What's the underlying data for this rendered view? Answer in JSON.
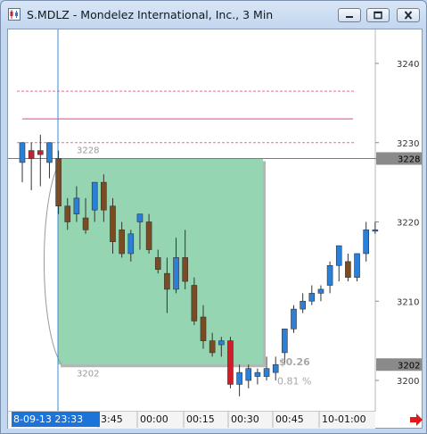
{
  "window": {
    "title": "S.MDLZ - Mondelez International, Inc., 3 Min"
  },
  "controls": {
    "minimize": "minimize-icon",
    "restore": "restore-icon",
    "close": "close-icon"
  },
  "chart_data": {
    "type": "candlestick",
    "symbol": "S.MDLZ",
    "interval": "3 Min",
    "price_axis": {
      "ticks": [
        "3240",
        "3230",
        "3220",
        "3210",
        "3200"
      ],
      "range": [
        3198.5,
        3242.2
      ],
      "current_price_label": "3228",
      "low_price_label": "3202"
    },
    "time_axis": {
      "ticks": [
        "8-09-13 23:33",
        "3:45",
        "00:00",
        "00:15",
        "00:30",
        "00:45",
        "10-01:00"
      ],
      "cursor_label": "8-09-13 23:33"
    },
    "candles": [
      {
        "o": 3227.5,
        "h": 3229.5,
        "l": 3225.0,
        "c": 3230.0
      },
      {
        "o": 3229.0,
        "h": 3230.0,
        "l": 3224.0,
        "c": 3228.0
      },
      {
        "o": 3229.0,
        "h": 3231.0,
        "l": 3224.5,
        "c": 3228.5
      },
      {
        "o": 3227.5,
        "h": 3230.0,
        "l": 3225.5,
        "c": 3230.0
      },
      {
        "o": 3228.0,
        "h": 3229.0,
        "l": 3221.0,
        "c": 3222.0
      },
      {
        "o": 3222.0,
        "h": 3223.0,
        "l": 3219.0,
        "c": 3220.0
      },
      {
        "o": 3221.0,
        "h": 3224.5,
        "l": 3220.0,
        "c": 3223.0
      },
      {
        "o": 3220.5,
        "h": 3223.0,
        "l": 3218.5,
        "c": 3219.0
      },
      {
        "o": 3221.5,
        "h": 3225.0,
        "l": 3220.0,
        "c": 3225.0
      },
      {
        "o": 3225.0,
        "h": 3226.0,
        "l": 3220.0,
        "c": 3221.5
      },
      {
        "o": 3222.0,
        "h": 3223.0,
        "l": 3216.0,
        "c": 3217.5
      },
      {
        "o": 3219.0,
        "h": 3220.0,
        "l": 3215.5,
        "c": 3216.0
      },
      {
        "o": 3216.0,
        "h": 3219.0,
        "l": 3215.0,
        "c": 3218.5
      },
      {
        "o": 3220.0,
        "h": 3221.0,
        "l": 3216.5,
        "c": 3221.0
      },
      {
        "o": 3220.0,
        "h": 3221.0,
        "l": 3216.0,
        "c": 3216.5
      },
      {
        "o": 3215.5,
        "h": 3216.5,
        "l": 3213.5,
        "c": 3214.0
      },
      {
        "o": 3213.5,
        "h": 3215.5,
        "l": 3208.5,
        "c": 3211.5
      },
      {
        "o": 3211.5,
        "h": 3218.0,
        "l": 3211.0,
        "c": 3215.5
      },
      {
        "o": 3215.5,
        "h": 3219.0,
        "l": 3211.5,
        "c": 3212.5
      },
      {
        "o": 3212.0,
        "h": 3213.0,
        "l": 3207.0,
        "c": 3207.5
      },
      {
        "o": 3208.0,
        "h": 3209.5,
        "l": 3204.0,
        "c": 3205.0
      },
      {
        "o": 3205.0,
        "h": 3206.0,
        "l": 3203.0,
        "c": 3203.5
      },
      {
        "o": 3204.5,
        "h": 3205.5,
        "l": 3203.0,
        "c": 3205.0
      },
      {
        "o": 3205.0,
        "h": 3205.5,
        "l": 3199.0,
        "c": 3199.5
      },
      {
        "o": 3199.5,
        "h": 3202.0,
        "l": 3198.0,
        "c": 3201.0
      },
      {
        "o": 3200.0,
        "h": 3202.0,
        "l": 3199.0,
        "c": 3201.5
      },
      {
        "o": 3200.5,
        "h": 3201.5,
        "l": 3199.5,
        "c": 3201.0
      },
      {
        "o": 3200.5,
        "h": 3203.0,
        "l": 3200.0,
        "c": 3201.5
      },
      {
        "o": 3201.0,
        "h": 3203.0,
        "l": 3200.0,
        "c": 3202.0
      },
      {
        "o": 3203.5,
        "h": 3205.0,
        "l": 3202.0,
        "c": 3206.5
      },
      {
        "o": 3206.5,
        "h": 3209.5,
        "l": 3206.0,
        "c": 3209.0
      },
      {
        "o": 3209.0,
        "h": 3211.0,
        "l": 3208.5,
        "c": 3210.0
      },
      {
        "o": 3210.0,
        "h": 3212.0,
        "l": 3209.5,
        "c": 3211.0
      },
      {
        "o": 3211.0,
        "h": 3212.0,
        "l": 3210.0,
        "c": 3211.5
      },
      {
        "o": 3212.0,
        "h": 3215.0,
        "l": 3211.0,
        "c": 3214.5
      },
      {
        "o": 3214.5,
        "h": 3217.0,
        "l": 3212.5,
        "c": 3217.0
      },
      {
        "o": 3215.0,
        "h": 3216.0,
        "l": 3212.5,
        "c": 3213.0
      },
      {
        "o": 3213.0,
        "h": 3216.0,
        "l": 3212.5,
        "c": 3216.0
      },
      {
        "o": 3216.0,
        "h": 3220.0,
        "l": 3215.0,
        "c": 3219.0
      },
      {
        "o": 3219.0,
        "h": 3220.0,
        "l": 3218.5,
        "c": 3219.0
      }
    ],
    "colors": {
      "up": "#2a7fd8",
      "down_dark": "#7b4b22",
      "down_red": "#cc1f2a",
      "crosshair": "#3a8cd8",
      "zone_fill": "#96d5b2",
      "reference_lines": "#e36aa8",
      "price_label_bg": "#8a8a8a",
      "time_label_bg": "#1e73d8",
      "arrow": "#e01a1a"
    },
    "horizontal_lines": [
      {
        "price": 3236.5,
        "style": "dashed"
      },
      {
        "price": 3233.0,
        "style": "solid"
      },
      {
        "price": 3230.0,
        "style": "dashed"
      },
      {
        "price": 3228.0,
        "style": "solid-gray"
      }
    ],
    "range_box": {
      "label_top": "3228",
      "label_bottom": "3202",
      "label_change": "$0.26",
      "label_percent": "0.81 %"
    },
    "crosshair": {
      "price": 3228.0,
      "time": "8-09-13 23:33"
    },
    "grid": true
  }
}
